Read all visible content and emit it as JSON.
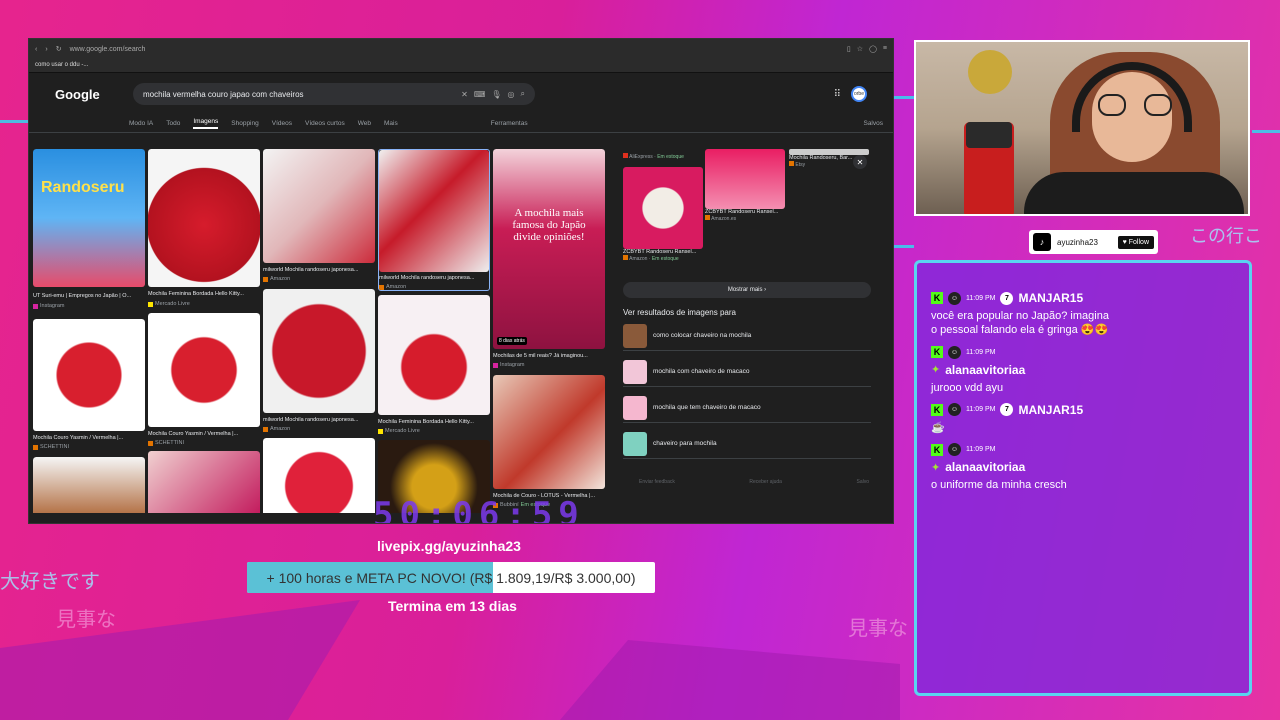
{
  "browser": {
    "url": "www.google.com/search",
    "bookmark": "como usar o ddu -...",
    "logo": "Google",
    "query": "mochila vermelha couro japao com chaveiros",
    "avatar_label": "orbe",
    "tabs": [
      "Modo IA",
      "Todo",
      "Imagens",
      "Shopping",
      "Vídeos",
      "Vídeos curtos",
      "Web",
      "Mais"
    ],
    "tools_label": "Ferramentas",
    "saved_label": "Salvos",
    "active_tab": "Imagens"
  },
  "images": [
    {
      "caption": "UT Suri-emu | Empregos no Japão | O...",
      "source": "Instagram",
      "overlay": "Randoseru"
    },
    {
      "caption": "Mochila Feminina Bordada Hello Kitty...",
      "source": "Mercado Livre"
    },
    {
      "caption": "milworld Mochila randoseru japonesa...",
      "source": "Amazon"
    },
    {
      "caption": "milworld Mochila randoseru japonesa...",
      "source": "Amazon"
    },
    {
      "caption": "Mochilas de 5 mil reais? Já imaginou...",
      "source": "Instagram",
      "overlay": "A mochila mais famosa do Japão divide opiniões!",
      "badge": "8 dias atrás"
    },
    {
      "caption": "Mochila Couro Yasmin / Vermelha |...",
      "source": "SCHETTINI"
    },
    {
      "caption": "Mochila Couro Yasmin / Vermelha |...",
      "source": "SCHETTINI"
    },
    {
      "caption": "milworld Mochila randoseru japonesa...",
      "source": "Amazon"
    },
    {
      "caption": "Mochila Feminina Bordada Hello Kitty...",
      "source": "Mercado Livre"
    },
    {
      "caption": "Mochila de Couro - LOTUS - Vermelha |...",
      "source": "Bubbiní",
      "stock": "Em estoque"
    }
  ],
  "side": {
    "top_source": "AliExpress",
    "top_stock": "Em estoque",
    "prod1_title": "ZCBYBT Randoseru Ransel...",
    "prod1_source": "Amazon",
    "prod1_stock": "Em estoque",
    "prod2_title": "ZCBYBT Randoseru Ransel...",
    "prod2_source": "Amazon.es",
    "prod3_title": "Mochila Randoseru, Bar...",
    "prod3_source": "Etsy",
    "show_more": "Mostrar mais",
    "related_title": "Ver resultados de imagens para",
    "related": [
      "como colocar chaveiro na mochila",
      "mochila com chaveiro de macaco",
      "mochila que tem chaveiro de macaco",
      "chaveiro para mochila"
    ],
    "footer": [
      "Enviar feedback",
      "Receber ajuda",
      "Salvo"
    ]
  },
  "timer": "50:06:59",
  "goal": {
    "site": "livepix.gg/ayuzinha23",
    "text": "+ 100 horas e META PC NOVO! (R$ 1.809,19/R$ 3.000,00)",
    "progress": 0.603,
    "ends": "Termina em 13 dias"
  },
  "overlay_text": {
    "left1": "大好きです",
    "left2": "見事な",
    "right1": "見事な",
    "right2": "この行こ"
  },
  "tiktok": {
    "handle": "ayuzinha23",
    "follow": "Follow"
  },
  "chat": [
    {
      "time": "11:09 PM",
      "num": "7",
      "user": "MANJAR15",
      "text": "você era popular no Japão? imagina o pessoal falando ela é gringa 😍😍"
    },
    {
      "time": "11:09 PM",
      "user": "alanaavitoriaa",
      "text": "jurooo vdd ayu"
    },
    {
      "time": "11:09 PM",
      "num": "7",
      "user": "MANJAR15",
      "text": "☕"
    },
    {
      "time": "11:09 PM",
      "user": "alanaavitoriaa",
      "text": "o uniforme da minha cresch"
    }
  ],
  "colors": {
    "accent": "#e6248e",
    "chat_border": "#5ad4f0",
    "goal_fill": "#5bc1d6",
    "kick": "#53fc18"
  }
}
